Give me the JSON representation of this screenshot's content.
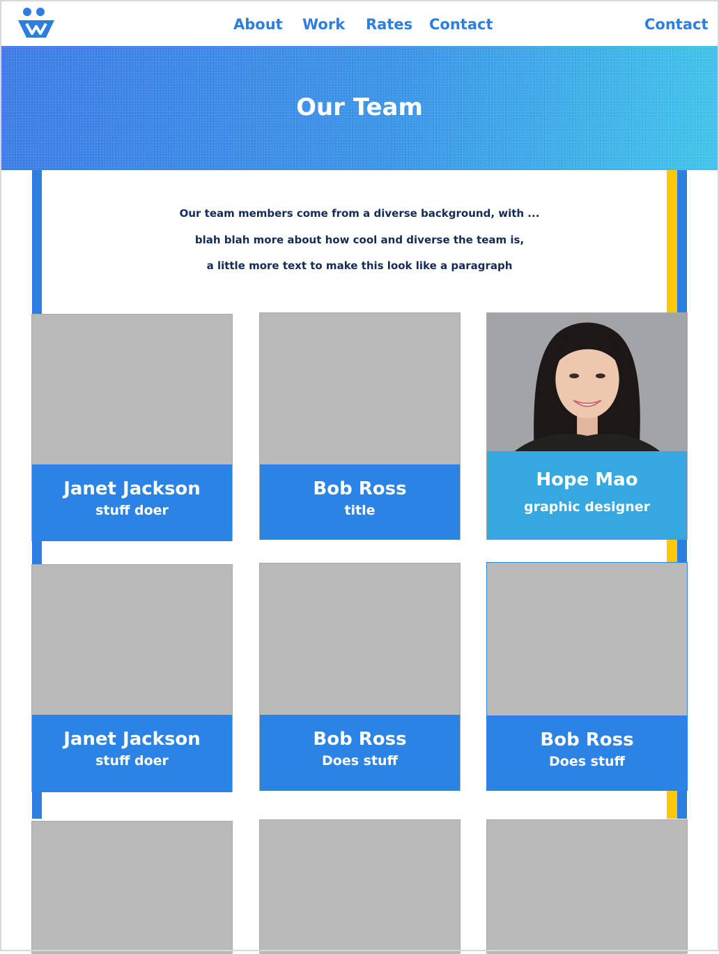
{
  "brand": {
    "logo": "people-logo-icon",
    "color": "#2c7fe0"
  },
  "nav": {
    "items": [
      {
        "label": "About"
      },
      {
        "label": "Work"
      },
      {
        "label": "Rates"
      },
      {
        "label": "Contact"
      }
    ],
    "cta": "Contact"
  },
  "hero": {
    "title": "Our Team"
  },
  "intro": {
    "lines": [
      "Our team members come from a diverse background, with ...",
      "blah blah more about how cool and diverse the team is,",
      "a little more text to make this look like a paragraph"
    ]
  },
  "team": [
    {
      "name": "Janet Jackson",
      "role": "stuff doer"
    },
    {
      "name": "Bob Ross",
      "role": "title"
    },
    {
      "name": "Hope Mao",
      "role": "graphic designer",
      "photo": "portrait-photo"
    },
    {
      "name": "Janet Jackson",
      "role": "stuff doer"
    },
    {
      "name": "Bob Ross",
      "role": "Does stuff"
    },
    {
      "name": "Bob Ross",
      "role": "Does stuff"
    },
    {
      "name": "",
      "role": ""
    },
    {
      "name": "",
      "role": ""
    },
    {
      "name": "",
      "role": ""
    }
  ],
  "colors": {
    "accent": "#2c7fe0",
    "card_label": "#2c83e6",
    "card_label_alt": "#37a7e0",
    "rail_yellow": "#fcc80a",
    "placeholder": "#b9b9b9"
  }
}
